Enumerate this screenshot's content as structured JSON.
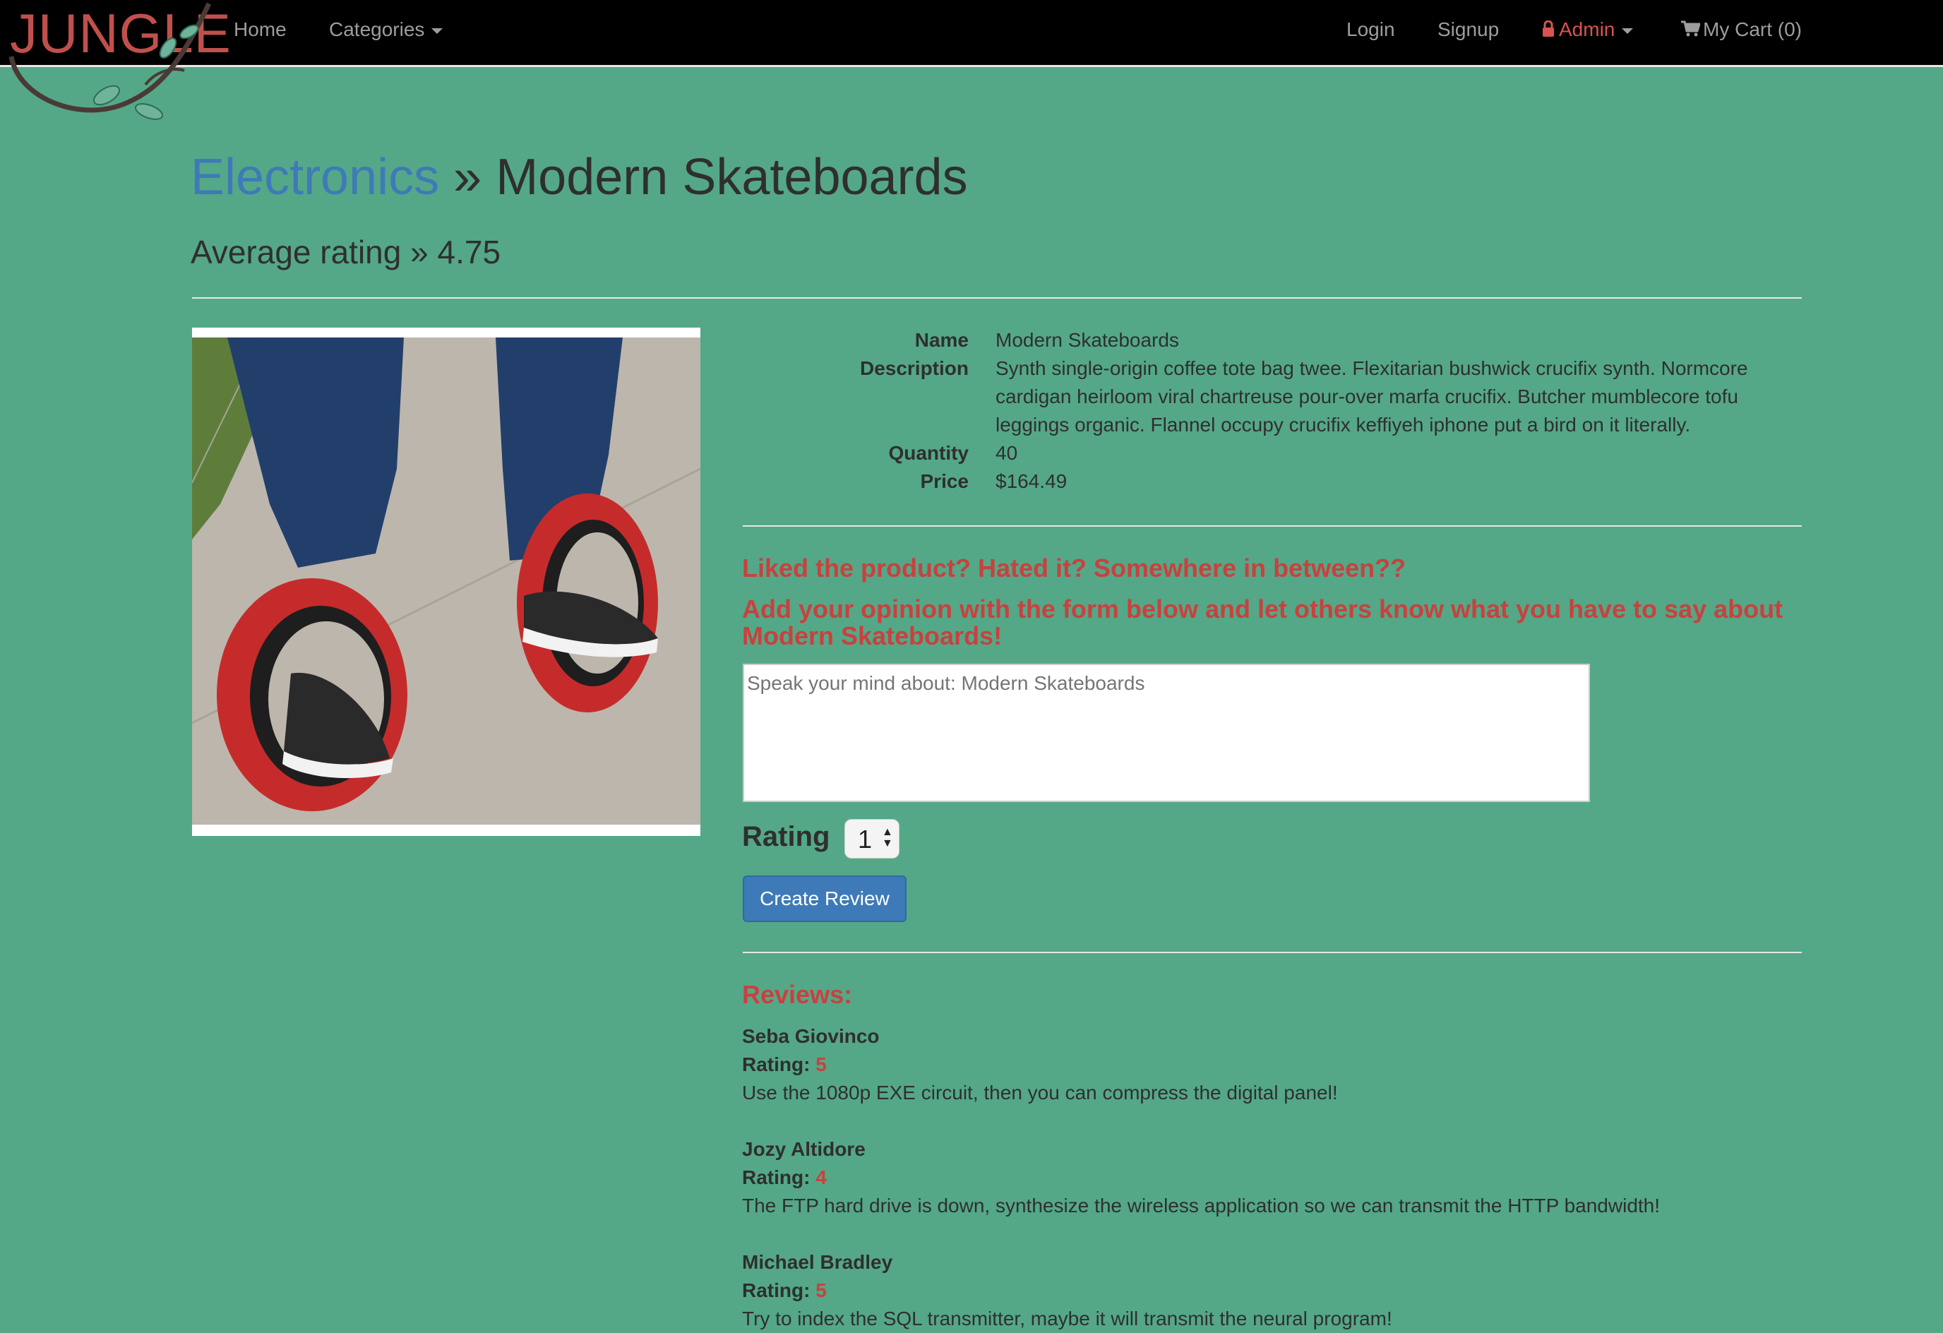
{
  "nav": {
    "brand": "JUNGLE",
    "home": "Home",
    "categories": "Categories",
    "login": "Login",
    "signup": "Signup",
    "admin": "Admin",
    "cart": "My Cart (0)"
  },
  "page": {
    "breadcrumb_category": "Electronics",
    "separator": "»",
    "product_title": "Modern Skateboards",
    "average_rating_label": "Average rating »",
    "average_rating_value": "4.75"
  },
  "product": {
    "image_alt": "skate rings product photo",
    "fields": [
      {
        "label": "Name",
        "value": "Modern Skateboards"
      },
      {
        "label": "Description",
        "value": "Synth single-origin coffee tote bag twee. Flexitarian bushwick crucifix synth. Normcore cardigan heirloom viral chartreuse pour-over marfa crucifix. Butcher mumblecore tofu leggings organic. Flannel occupy crucifix keffiyeh iphone put a bird on it literally."
      },
      {
        "label": "Quantity",
        "value": "40"
      },
      {
        "label": "Price",
        "value": "$164.49"
      }
    ]
  },
  "review_form": {
    "prompt_1": "Liked the product? Hated it? Somewhere in between??",
    "prompt_2": "Add your opinion with the form below and let others know what you have to say about Modern Skateboards!",
    "textarea_placeholder": "Speak your mind about: Modern Skateboards",
    "rating_label": "Rating",
    "rating_value": "1",
    "submit_label": "Create Review"
  },
  "reviews": {
    "heading": "Reviews:",
    "rating_prefix": "Rating:",
    "items": [
      {
        "author": "Seba Giovinco",
        "rating": "5",
        "text": "Use the 1080p EXE circuit, then you can compress the digital panel!"
      },
      {
        "author": "Jozy Altidore",
        "rating": "4",
        "text": "The FTP hard drive is down, synthesize the wireless application so we can transmit the HTTP bandwidth!"
      },
      {
        "author": "Michael Bradley",
        "rating": "5",
        "text": "Try to index the SQL transmitter, maybe it will transmit the neural program!"
      }
    ]
  },
  "colors": {
    "background": "#54a887",
    "navbar": "#000000",
    "accent_red": "#c9413e",
    "link_blue": "#3e7ab8"
  }
}
